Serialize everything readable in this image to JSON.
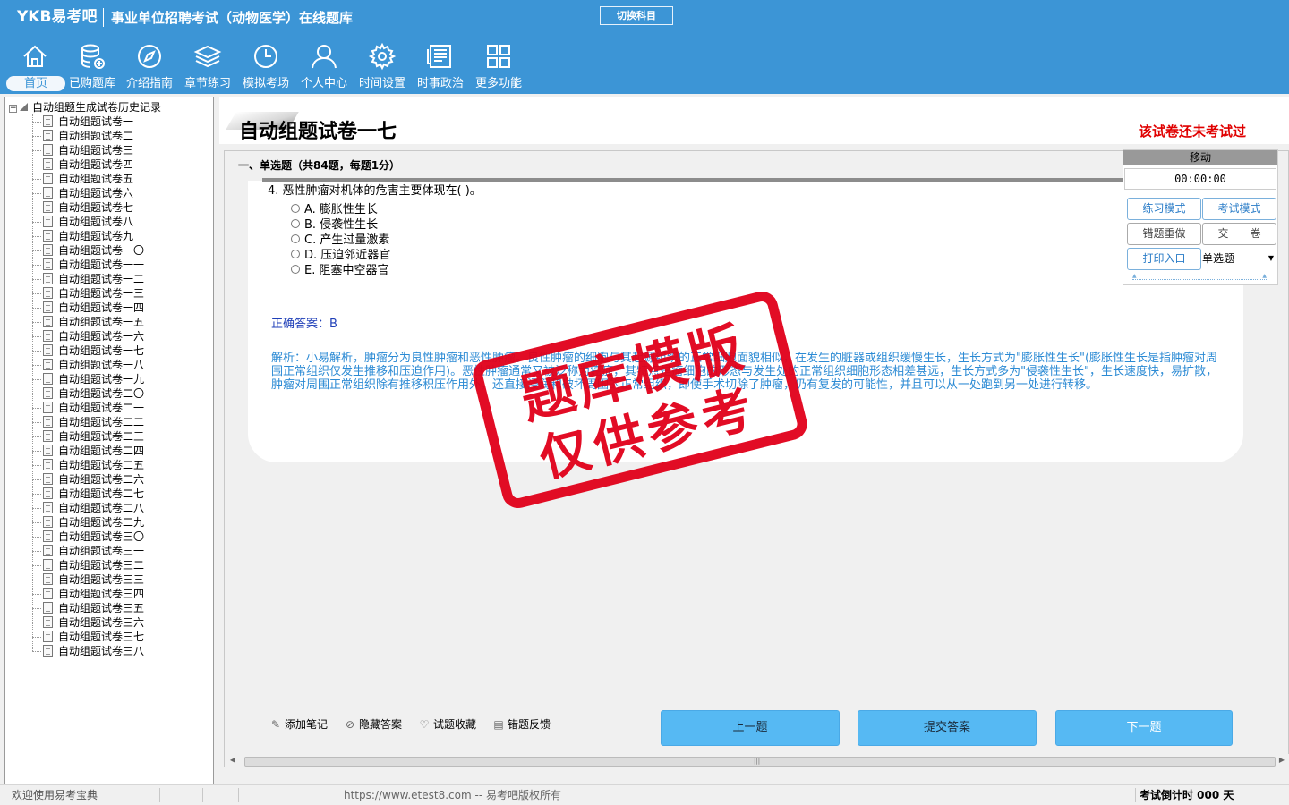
{
  "header": {
    "logo": "YKB易考吧",
    "app_title": "事业单位招聘考试（动物医学）在线题库",
    "switch_label": "切换科目"
  },
  "nav": [
    {
      "label": "首页",
      "icon": "home-icon",
      "active": true
    },
    {
      "label": "已购题库",
      "icon": "database-icon"
    },
    {
      "label": "介绍指南",
      "icon": "compass-icon"
    },
    {
      "label": "章节练习",
      "icon": "layers-icon"
    },
    {
      "label": "模拟考场",
      "icon": "clock-icon"
    },
    {
      "label": "个人中心",
      "icon": "user-icon"
    },
    {
      "label": "时间设置",
      "icon": "gear-icon"
    },
    {
      "label": "时事政治",
      "icon": "newspaper-icon"
    },
    {
      "label": "更多功能",
      "icon": "grid-icon"
    }
  ],
  "tree": {
    "root": "自动组题生成试卷历史记录",
    "items": [
      "自动组题试卷一",
      "自动组题试卷二",
      "自动组题试卷三",
      "自动组题试卷四",
      "自动组题试卷五",
      "自动组题试卷六",
      "自动组题试卷七",
      "自动组题试卷八",
      "自动组题试卷九",
      "自动组题试卷一〇",
      "自动组题试卷一一",
      "自动组题试卷一二",
      "自动组题试卷一三",
      "自动组题试卷一四",
      "自动组题试卷一五",
      "自动组题试卷一六",
      "自动组题试卷一七",
      "自动组题试卷一八",
      "自动组题试卷一九",
      "自动组题试卷二〇",
      "自动组题试卷二一",
      "自动组题试卷二二",
      "自动组题试卷二三",
      "自动组题试卷二四",
      "自动组题试卷二五",
      "自动组题试卷二六",
      "自动组题试卷二七",
      "自动组题试卷二八",
      "自动组题试卷二九",
      "自动组题试卷三〇",
      "自动组题试卷三一",
      "自动组题试卷三二",
      "自动组题试卷三三",
      "自动组题试卷三四",
      "自动组题试卷三五",
      "自动组题试卷三六",
      "自动组题试卷三七",
      "自动组题试卷三八"
    ]
  },
  "paper": {
    "title": "自动组题试卷一七",
    "status": "该试卷还未考试过",
    "section": "一、单选题（共84题，每题1分）"
  },
  "question": {
    "text": "4. 恶性肿瘤对机体的危害主要体现在( )。",
    "options": [
      "A. 膨胀性生长",
      "B. 侵袭性生长",
      "C. 产生过量激素",
      "D. 压迫邻近器官",
      "E. 阻塞中空器官"
    ],
    "answer": "正确答案：B",
    "analysis": "解析：小易解析，肿瘤分为良性肿瘤和恶性肿瘤。良性肿瘤的细胞与其起源组织的正常细胞面貌相似，在发生的脏器或组织缓慢生长，生长方式为\"膨胀性生长\"(膨胀性生长是指肿瘤对周围正常组织仅发生推移和压迫作用)。恶性肿瘤通常又被泛称为癌症，其特点是瘤细胞的形态与发生处的正常组织细胞形态相差甚远，生长方式多为\"侵袭性生长\"，生长速度快，易扩散，肿瘤对周围正常组织除有推移积压作用外，还直接浸润和破坏周围的正常组织，即使手术切除了肿瘤，仍有复发的可能性，并且可以从一处跑到另一处进行转移。"
  },
  "bottom_actions": {
    "note": "添加笔记",
    "hide_answer": "隐藏答案",
    "favorite": "试题收藏",
    "feedback": "错题反馈",
    "prev": "上一题",
    "submit": "提交答案",
    "next": "下一题"
  },
  "float_panel": {
    "move": "移动",
    "timer": "00:00:00",
    "practice": "练习模式",
    "exam": "考试模式",
    "redo": "错题重做",
    "hand_in": "交　　卷",
    "print": "打印入口",
    "type": "单选题"
  },
  "status": {
    "welcome": "欢迎使用易考宝典",
    "copyright": "https://www.etest8.com -- 易考吧版权所有",
    "countdown": "考试倒计时 000 天"
  },
  "watermark": {
    "line1": "题库模版",
    "line2": "仅供参考"
  },
  "colors": {
    "header_bg": "#3c95d6",
    "accent_red": "#e00000",
    "button_blue": "#56b9f3",
    "answer_blue": "#1f3fb8",
    "analysis_blue": "#2b8ad4"
  }
}
